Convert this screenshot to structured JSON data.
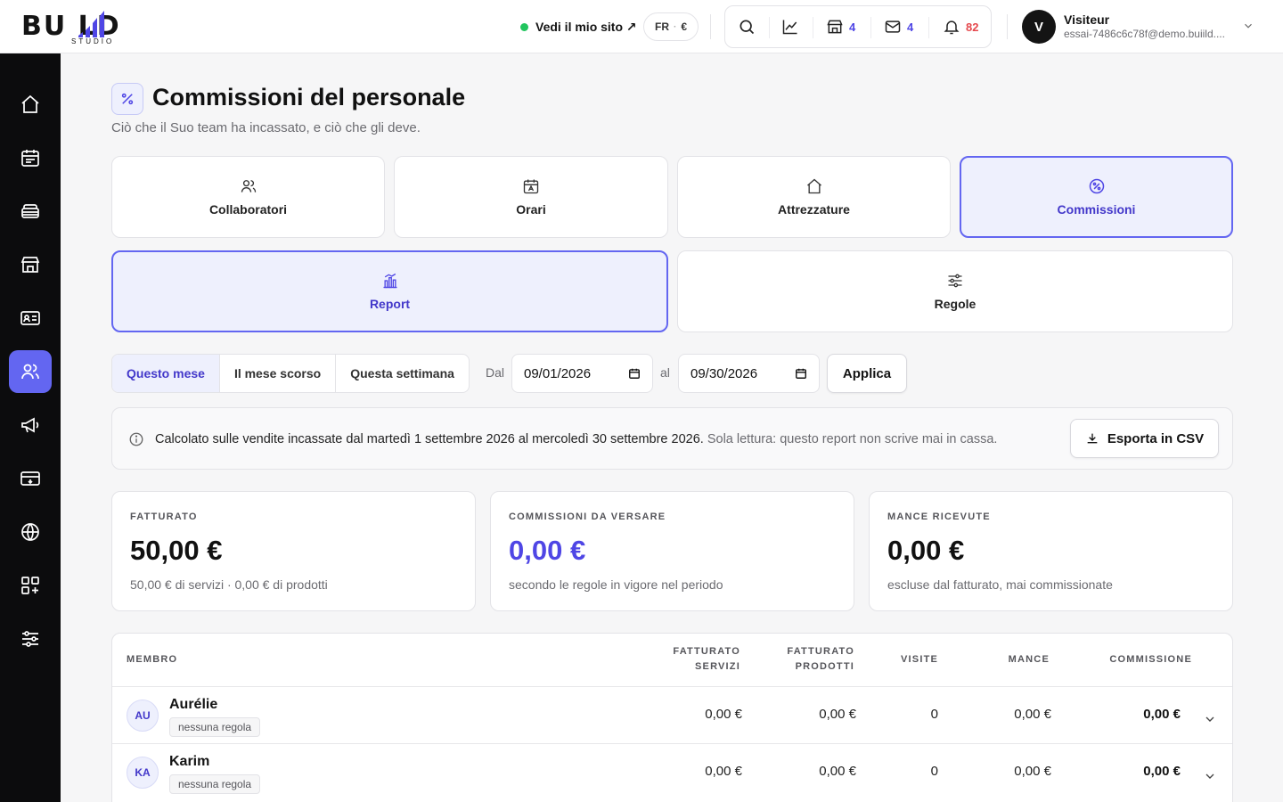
{
  "header": {
    "logo_text": "BU  LD",
    "logo_sub": "STUDIO",
    "site_link": "Vedi il mio sito ↗",
    "lang": "FR",
    "currency": "€",
    "tools": {
      "shop_count": "4",
      "mail_count": "4",
      "bell_count": "82"
    },
    "user": {
      "initial": "V",
      "name": "Visiteur",
      "email": "essai-7486c6c78f@demo.buiild...."
    }
  },
  "page": {
    "title": "Commissioni del personale",
    "subtitle": "Ciò che il Suo team ha incassato, e ciò che gli deve."
  },
  "tiles": {
    "collaboratori": "Collaboratori",
    "orari": "Orari",
    "attrezzature": "Attrezzature",
    "commissioni": "Commissioni",
    "report": "Report",
    "regole": "Regole"
  },
  "period": {
    "this_month": "Questo mese",
    "last_month": "Il mese scorso",
    "this_week": "Questa settimana",
    "from_label": "Dal",
    "from_value": "09/01/2026",
    "to_label": "al",
    "to_value": "09/30/2026",
    "apply": "Applica"
  },
  "info": {
    "main": "Calcolato sulle vendite incassate dal martedì 1 settembre 2026 al mercoledì 30 settembre 2026.",
    "note": "Sola lettura: questo report non scrive mai in cassa.",
    "export": "Esporta in CSV"
  },
  "stats": {
    "revenue": {
      "label": "FATTURATO",
      "value": "50,00 €",
      "sub": "50,00 € di servizi · 0,00 € di prodotti"
    },
    "commissions": {
      "label": "COMMISSIONI DA VERSARE",
      "value": "0,00 €",
      "sub": "secondo le regole in vigore nel periodo"
    },
    "tips": {
      "label": "MANCE RICEVUTE",
      "value": "0,00 €",
      "sub": "escluse dal fatturato, mai commissionate"
    }
  },
  "table": {
    "headers": {
      "member": "MEMBRO",
      "services_1": "FATTURATO",
      "services_2": "SERVIZI",
      "products_1": "FATTURATO",
      "products_2": "PRODOTTI",
      "visits": "VISITE",
      "tips": "MANCE",
      "commission": "COMMISSIONE"
    },
    "rows": [
      {
        "initials": "AU",
        "name": "Aurélie",
        "badge": "nessuna regola",
        "services": "0,00 €",
        "products": "0,00 €",
        "visits": "0",
        "tips": "0,00 €",
        "commission": "0,00 €"
      },
      {
        "initials": "KA",
        "name": "Karim",
        "badge": "nessuna regola",
        "services": "0,00 €",
        "products": "0,00 €",
        "visits": "0",
        "tips": "0,00 €",
        "commission": "0,00 €"
      }
    ]
  },
  "colors": {
    "accent": "#6366f1",
    "accent_text": "#4338ca",
    "online": "#22c55e",
    "alert": "#e5484d"
  }
}
